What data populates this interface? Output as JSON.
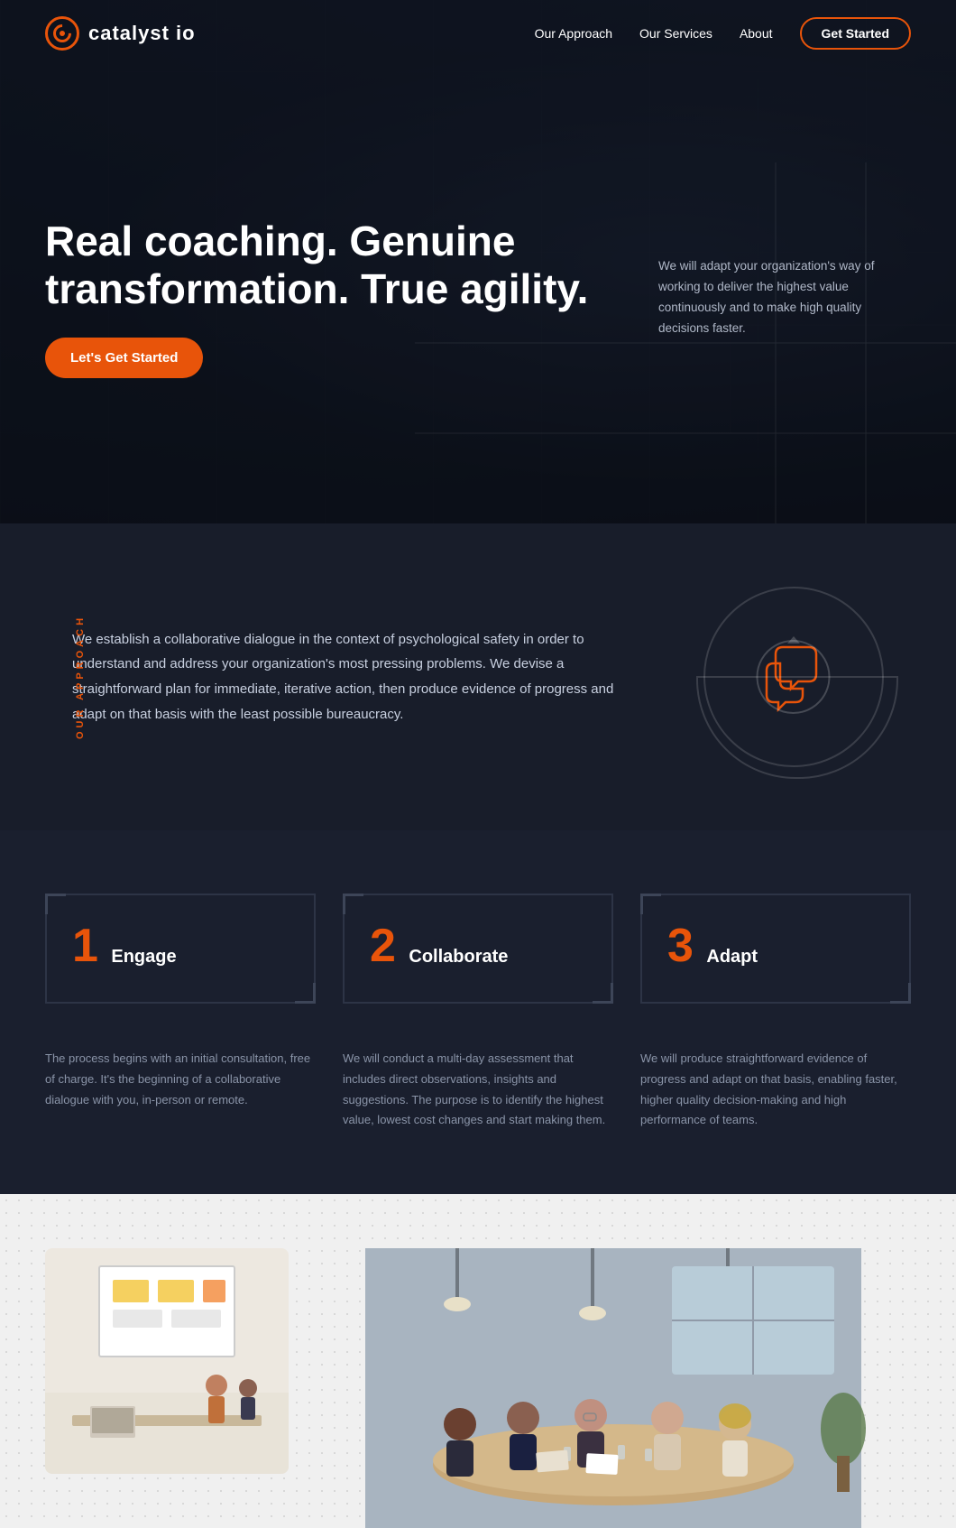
{
  "brand": {
    "name": "catalyst io",
    "logo_icon": "target-icon"
  },
  "nav": {
    "links": [
      {
        "label": "Our Approach",
        "id": "our-approach"
      },
      {
        "label": "Our Services",
        "id": "our-services"
      },
      {
        "label": "About",
        "id": "about"
      }
    ],
    "cta_label": "Get Started"
  },
  "hero": {
    "title": "Real coaching. Genuine transformation. True agility.",
    "description": "We will adapt your organization's way of working to deliver the highest value continuously and to make high quality decisions faster.",
    "cta_label": "Let's Get Started"
  },
  "approach": {
    "section_label": "OUR APPROACH",
    "body": "We establish a collaborative dialogue in the context of psychological safety in order to understand and address your organization's most pressing problems. We devise a straightforward plan for immediate, iterative action, then produce evidence of progress and adapt on that basis with the least possible bureaucracy."
  },
  "steps": [
    {
      "number": "1",
      "title": "Engage",
      "description": "The process begins with an initial consultation, free of charge. It's the beginning of a collaborative dialogue with you, in-person or remote."
    },
    {
      "number": "2",
      "title": "Collaborate",
      "description": "We will conduct a multi-day assessment that includes direct observations, insights and suggestions. The purpose is to identify the highest value, lowest cost changes and start making them."
    },
    {
      "number": "3",
      "title": "Adapt",
      "description": "We will produce straightforward evidence of progress and adapt on that basis, enabling faster, higher quality decision-making and high performance of teams."
    }
  ],
  "colors": {
    "accent": "#e8540a",
    "bg_dark": "#1a1f2e",
    "bg_darker": "#181d2a",
    "text_muted": "#8a94a8",
    "text_light": "#c8d0e0",
    "border": "#2d3446"
  }
}
